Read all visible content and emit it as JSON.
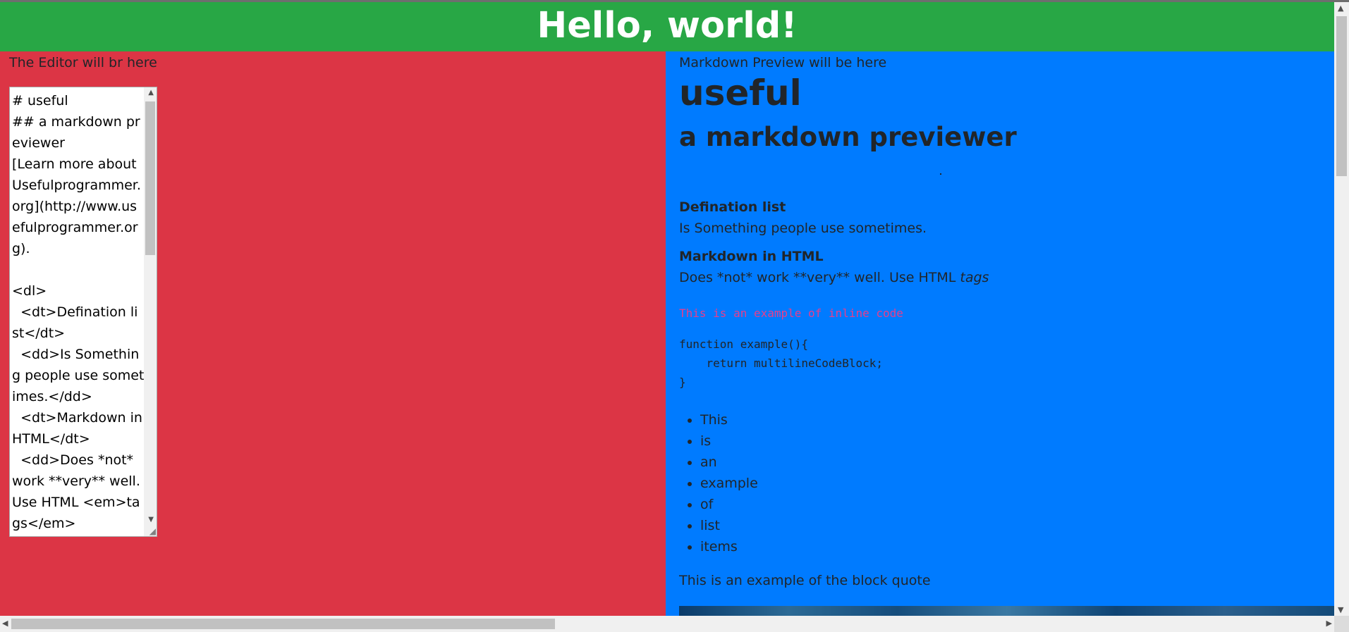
{
  "header": {
    "title": "Hello, world!"
  },
  "editor": {
    "caption": "The Editor will br here",
    "text": "# useful\n## a markdown previewer\n[Learn more about Usefulprogrammer.org](http://www.usefulprogrammer.org).\n\n<dl>\n  <dt>Defination list</dt>\n  <dd>Is Something people use sometimes.</dd>\n  <dt>Markdown in HTML</dt>\n  <dd>Does *not* work **very** well. Use HTML <em>tags</em>"
  },
  "preview": {
    "caption": "Markdown Preview will be here",
    "h1": "useful",
    "h2": "a markdown previewer",
    "dt1": "Defination list",
    "dd1": "Is Something people use sometimes.",
    "dt2": "Markdown in HTML",
    "dd2_text": "Does *not* work **very** well. Use HTML ",
    "dd2_em": "tags",
    "inline_code": "This is an example of inline code",
    "code_block": "function example(){\n    return multilineCodeBlock;\n}",
    "list_items": [
      "This",
      "is",
      "an",
      "example",
      "of",
      "list",
      "items"
    ],
    "blockquote": "This is an example of the block quote"
  },
  "colors": {
    "header": "#28a745",
    "editor_bg": "#dc3545",
    "preview_bg": "#007bff",
    "inline_code": "#e83e8c"
  },
  "icons": {
    "scroll_up": "▲",
    "scroll_down": "▼",
    "scroll_left": "◀",
    "scroll_right": "▶",
    "resize_grip": "◢"
  }
}
